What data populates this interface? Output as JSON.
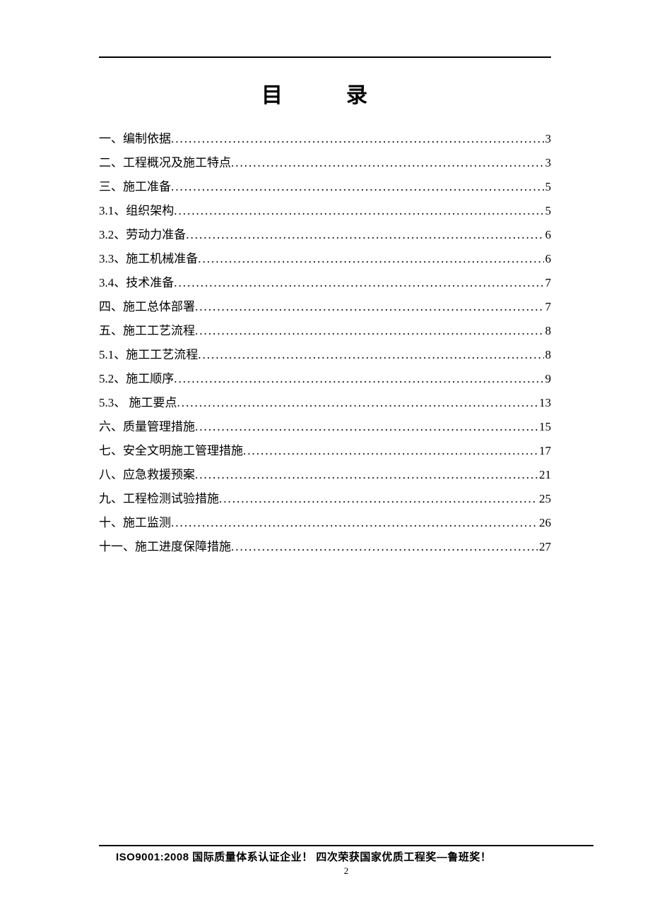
{
  "title": "目　录",
  "toc": [
    {
      "label": "一、编制依据",
      "page": "3"
    },
    {
      "label": "二、工程概况及施工特点",
      "page": "3"
    },
    {
      "label": "三、施工准备",
      "page": "5"
    },
    {
      "label": "3.1、组织架构",
      "page": "5"
    },
    {
      "label": "3.2、劳动力准备",
      "page": "6"
    },
    {
      "label": "3.3、施工机械准备",
      "page": "6"
    },
    {
      "label": "3.4、技术准备",
      "page": "7"
    },
    {
      "label": "四、施工总体部署",
      "page": "7"
    },
    {
      "label": "五、施工工艺流程",
      "page": "8"
    },
    {
      "label": "5.1、施工工艺流程",
      "page": "8"
    },
    {
      "label": "5.2、施工顺序",
      "page": "9"
    },
    {
      "label": "5.3、 施工要点",
      "page": "13"
    },
    {
      "label": "六、质量管理措施",
      "page": "15"
    },
    {
      "label": "七、安全文明施工管理措施",
      "page": "17"
    },
    {
      "label": "八、应急救援预案",
      "page": "21"
    },
    {
      "label": "九、工程检测试验措施",
      "page": "25"
    },
    {
      "label": "十、施工监测",
      "page": "26"
    },
    {
      "label": "十一、施工进度保障措施",
      "page": "27"
    }
  ],
  "footer": "ISO9001:2008 国际质量体系认证企业！ 四次荣获国家优质工程奖—鲁班奖！",
  "pageNumber": "2",
  "dots": ".................................................................................................................."
}
